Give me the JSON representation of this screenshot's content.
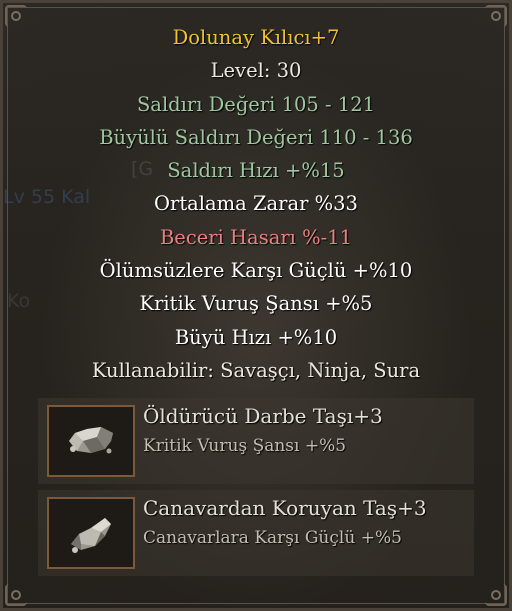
{
  "item": {
    "name": "Dolunay Kılıcı+7",
    "level": "Level: 30",
    "attack_value": "Saldırı Değeri 105 - 121",
    "magic_attack_value": "Büyülü Saldırı Değeri 110 - 136",
    "attack_speed": "Saldırı Hızı +%15",
    "average_damage": "Ortalama Zarar %33",
    "skill_damage": "Beceri Hasarı %-11",
    "bonus_undead": "Ölümsüzlere Karşı Güçlü +%10",
    "bonus_critical": "Kritik Vuruş Şansı +%5",
    "bonus_cast_speed": "Büyü Hızı +%10",
    "usable_by": "Kullanabilir:  Savaşçı, Ninja, Sura"
  },
  "sockets": [
    {
      "name": "Öldürücü Darbe Taşı+3",
      "bonus": "Kritik Vuruş Şansı +%5",
      "icon": "stone-icon"
    },
    {
      "name": "Canavardan Koruyan Taş+3",
      "bonus": "Canavarlara Karşı Güçlü +%5",
      "icon": "stone-icon"
    }
  ],
  "background": {
    "ghost_text_1": "[G",
    "ghost_text_2": "Lv 55 Kal",
    "ghost_text_3": "Ko"
  },
  "colors": {
    "title": "#f2c232",
    "stat_green": "#9fc8a0",
    "penalty_red": "#e88080",
    "socket_frame": "#7a5a3a"
  }
}
